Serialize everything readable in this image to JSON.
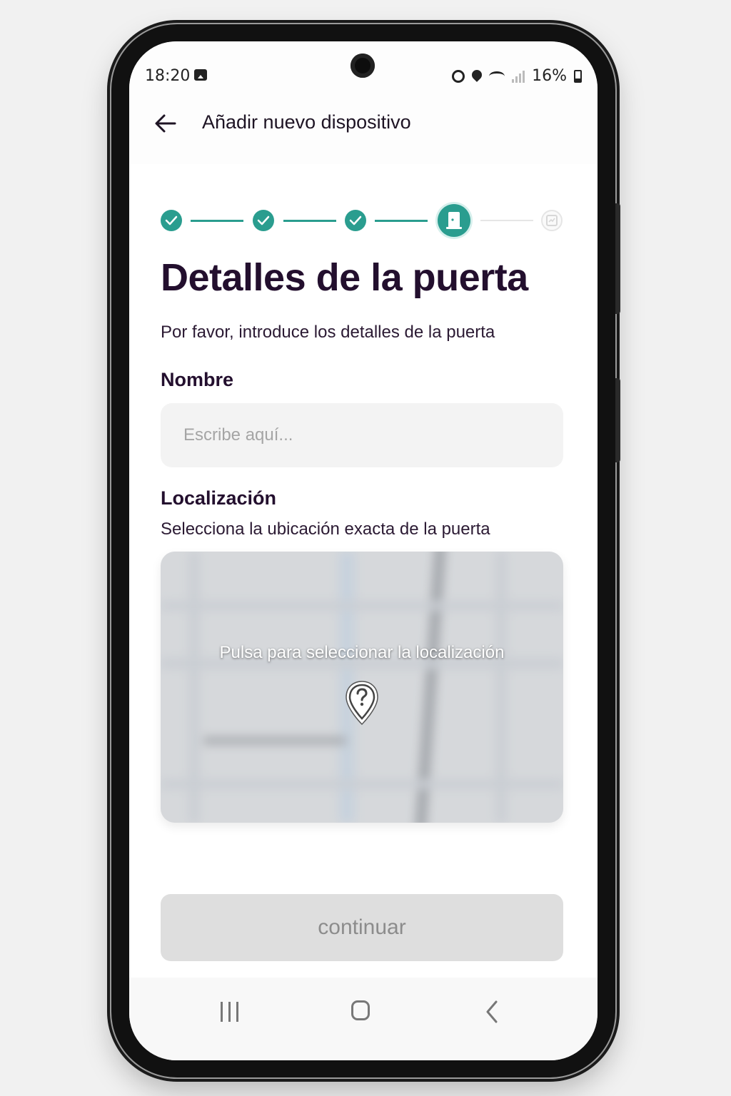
{
  "status_bar": {
    "time": "18:20",
    "battery": "16%"
  },
  "app_bar": {
    "title": "Añadir nuevo dispositivo"
  },
  "stepper": {
    "total_steps": 5,
    "completed_steps": 3,
    "current_step": 4
  },
  "page": {
    "title": "Detalles de la puerta",
    "subtitle": "Por favor, introduce los detalles de la puerta"
  },
  "name_field": {
    "label": "Nombre",
    "placeholder": "Escribe aquí...",
    "value": ""
  },
  "location": {
    "label": "Localización",
    "description": "Selecciona la ubicación exacta de la puerta",
    "map_prompt": "Pulsa para seleccionar la localización"
  },
  "continue_button": {
    "label": "continuar",
    "enabled": false
  },
  "colors": {
    "accent": "#2a9d8f",
    "title": "#230f2e",
    "button_disabled": "#dedede"
  }
}
